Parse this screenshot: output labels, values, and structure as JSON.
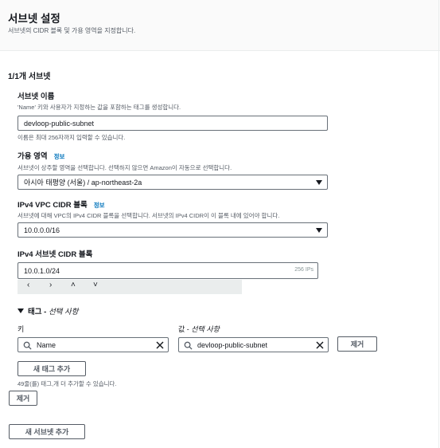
{
  "header": {
    "title": "서브넷 설정",
    "description": "서브넷의 CIDR 블록 및 가용 영역을 지정합니다."
  },
  "subnet": {
    "counter": "1/1개 서브넷",
    "name": {
      "label": "서브넷 이름",
      "description": "'Name' 키와 사용자가 지정하는 값을 포함하는 태그를 생성합니다.",
      "value": "devloop-public-subnet",
      "hint": "이름은 최대 256자까지 입력할 수 있습니다."
    },
    "az": {
      "label": "가용 영역",
      "info": "정보",
      "description": "서브넷이 상주할 영역을 선택합니다. 선택하지 않으면 Amazon이 자동으로 선택합니다.",
      "value": "아시아 태평양 (서울) / ap-northeast-2a"
    },
    "vpc_cidr": {
      "label": "IPv4 VPC CIDR 블록",
      "info": "정보",
      "description": "서브넷에 대해 VPC의 IPv4 CIDR 블록을 선택합니다. 서브넷의 IPv4 CIDR이 이 블록 내에 있어야 합니다.",
      "value": "10.0.0.0/16"
    },
    "subnet_cidr": {
      "label": "IPv4 서브넷 CIDR 블록",
      "value": "10.0.1.0/24",
      "ip_count": "256 IPs",
      "stepper": [
        "‹",
        "›",
        "˄",
        "˅"
      ]
    },
    "tags": {
      "toggle_label": "태그 - ",
      "toggle_optional": "선택 사항",
      "key_label": "키",
      "value_label": "값 - ",
      "value_optional": "선택 사항",
      "key": "Name",
      "value": "devloop-public-subnet",
      "remove_tag_label": "제거",
      "add_tag_label": "새 태그 추가",
      "remaining_hint": "49줄(를) 태그,개 더 추가할 수 있습니다."
    },
    "remove_subnet_label": "제거"
  },
  "add_subnet_label": "새 서브넷 추가"
}
